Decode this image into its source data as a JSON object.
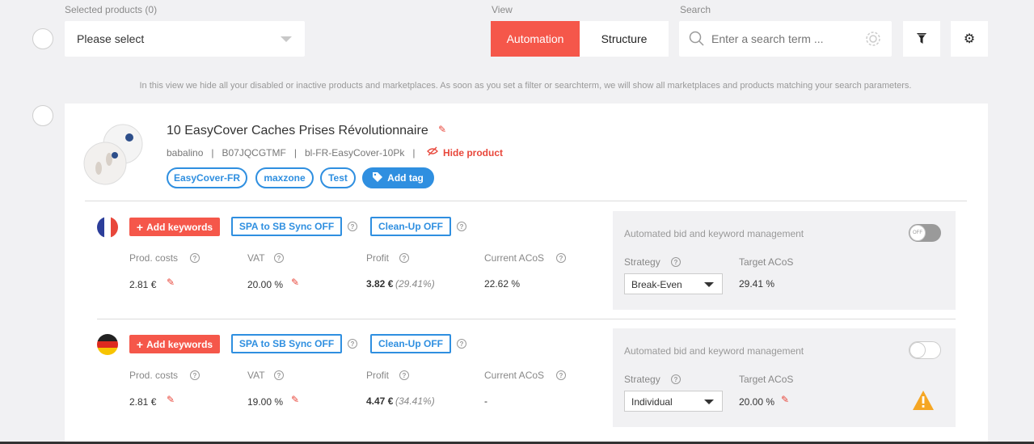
{
  "toolbar": {
    "selected_label": "Selected products (0)",
    "select_value": "Please select",
    "view_label": "View",
    "view_automation": "Automation",
    "view_structure": "Structure",
    "search_label": "Search",
    "search_placeholder": "Enter a search term ..."
  },
  "info_text": "In this view we hide all your disabled or inactive products and marketplaces. As soon as you set a filter or searchterm, we will show all marketplaces and products matching your search parameters.",
  "product": {
    "title": "10 EasyCover Caches Prises Révolutionnaire",
    "brand": "babalino",
    "asin": "B07JQCGTMF",
    "sku": "bl-FR-EasyCover-10Pk",
    "hide_label": "Hide product",
    "tags": [
      "EasyCover-FR",
      "maxzone",
      "Test"
    ],
    "add_tag_label": "Add tag"
  },
  "headers": {
    "prod_costs": "Prod. costs",
    "vat": "VAT",
    "profit": "Profit",
    "current_acos": "Current ACoS",
    "auto_title": "Automated bid and keyword management",
    "strategy": "Strategy",
    "target_acos": "Target ACoS"
  },
  "buttons": {
    "add_keywords": "Add keywords",
    "spa_sync": "SPA to SB Sync OFF",
    "cleanup": "Clean-Up OFF"
  },
  "marketplaces": [
    {
      "country": "France",
      "prod_costs": "2.81 €",
      "vat": "20.00 %",
      "profit": "3.82 €",
      "profit_pct": "(29.41%)",
      "current_acos": "22.62 %",
      "toggle_label": "OFF",
      "strategy": "Break-Even",
      "target_acos": "29.41 %"
    },
    {
      "country": "Germany",
      "prod_costs": "2.81 €",
      "vat": "19.00 %",
      "profit": "4.47 €",
      "profit_pct": "(34.41%)",
      "current_acos": "-",
      "toggle_label": "",
      "strategy": "Individual",
      "target_acos": "20.00 %"
    }
  ],
  "colors": {
    "accent": "#f5574a",
    "blue": "#2f8fe0",
    "background": "#f1f1f3"
  }
}
